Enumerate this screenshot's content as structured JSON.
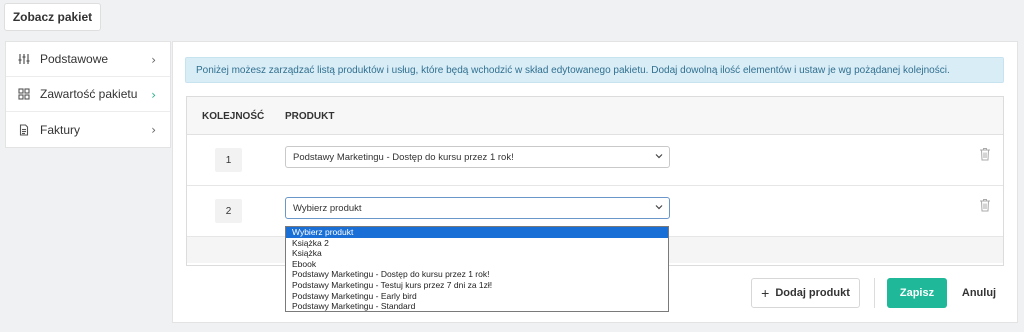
{
  "top_button": {
    "label": "Zobacz pakiet"
  },
  "sidebar": {
    "items": [
      {
        "label": "Podstawowe",
        "icon": "sliders-icon",
        "active": false
      },
      {
        "label": "Zawartość pakietu",
        "icon": "grid-icon",
        "active": true
      },
      {
        "label": "Faktury",
        "icon": "document-icon",
        "active": false
      }
    ]
  },
  "info": {
    "text": "Poniżej możesz zarządzać listą produktów i usług, które będą wchodzić w skład edytowanego pakietu. Dodaj dowolną ilość elementów i ustaw je wg pożądanej kolejności."
  },
  "table": {
    "headers": {
      "order": "KOLEJNOŚĆ",
      "product": "PRODUKT"
    },
    "rows": [
      {
        "order": "1",
        "product": "Podstawy Marketingu - Dostęp do kursu przez 1 rok!"
      },
      {
        "order": "2",
        "product": "Wybierz produkt"
      }
    ]
  },
  "dropdown": {
    "options": [
      "Wybierz produkt",
      "Książka 2",
      "Książka",
      "Ebook",
      "Podstawy Marketingu - Dostęp do kursu przez 1 rok!",
      "Podstawy Marketingu - Testuj kurs przez 7 dni za 1zł!",
      "Podstawy Marketingu - Early bird",
      "Podstawy Marketingu - Standard"
    ],
    "selected_index": 0
  },
  "actions": {
    "add_label": "Dodaj produkt",
    "save_label": "Zapisz",
    "cancel_label": "Anuluj"
  },
  "colors": {
    "accent": "#1fb898",
    "info_bg": "#d9edf7",
    "info_text": "#31708f",
    "selection": "#1a6fd6"
  }
}
